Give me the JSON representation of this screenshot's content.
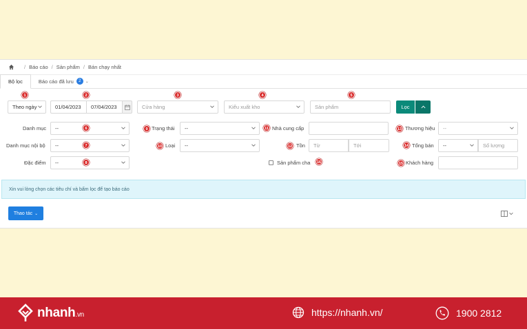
{
  "breadcrumb": {
    "home_icon": "home-icon",
    "items": [
      "Báo cáo",
      "Sản phẩm",
      "Bán chạy nhất"
    ]
  },
  "tabs": [
    {
      "label": "Bộ lọc",
      "active": true
    },
    {
      "label": "Báo cáo đã lưu",
      "badge": "2"
    }
  ],
  "filters": {
    "period": {
      "value": "Theo ngày"
    },
    "date_from": "01/04/2023",
    "date_to": "07/04/2023",
    "store": {
      "placeholder": "Cửa hàng"
    },
    "export_type": {
      "placeholder": "Kiểu xuất kho"
    },
    "product": {
      "placeholder": "Sản phẩm"
    },
    "filter_button": "Lọc",
    "category": {
      "label": "Danh mục",
      "value": "--"
    },
    "status": {
      "label": "Trạng thái",
      "value": "--"
    },
    "supplier": {
      "label": "Nhà cung cấp"
    },
    "brand": {
      "label": "Thương hiệu",
      "value": "--"
    },
    "internal_category": {
      "label": "Danh mục nội bộ",
      "value": "--"
    },
    "type": {
      "label": "Loại",
      "value": "--"
    },
    "stock": {
      "label": "Tồn",
      "from": "Từ",
      "to": "Tới"
    },
    "total_sold": {
      "label": "Tổng bán",
      "value": "--",
      "qty_placeholder": "Số lượng"
    },
    "attribute": {
      "label": "Đặc điểm",
      "value": "--"
    },
    "parent_product": {
      "label": "Sản phẩm cha"
    },
    "customer": {
      "label": "Khách hàng"
    }
  },
  "markers": [
    "1",
    "2",
    "3",
    "4",
    "5",
    "6",
    "7",
    "8",
    "9",
    "10",
    "11",
    "12",
    "13",
    "14",
    "15",
    "16"
  ],
  "info_message": "Xin vui lòng chọn các tiêu chí và bấm lọc để tạo báo cáo",
  "actions_button": "Thao tác",
  "footer": {
    "brand": "nhanh",
    "brand_suffix": ".vn",
    "website": "https://nhanh.vn/",
    "phone": "1900 2812"
  },
  "colors": {
    "background": "#fdf6d3",
    "marker": "#d92b2b",
    "filter_button": "#0b8a7a",
    "action_button": "#1f7fe0",
    "footer": "#c8202e"
  }
}
